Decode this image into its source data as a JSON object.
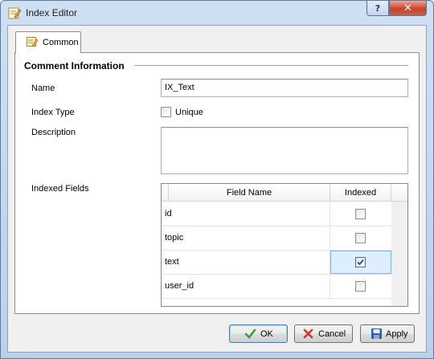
{
  "window": {
    "title": "Index Editor",
    "help_label": "?",
    "close_label": "✕"
  },
  "tabs": [
    {
      "label": "Common",
      "icon": "edit-sheet-icon",
      "active": true
    }
  ],
  "form": {
    "section_title": "Comment Information",
    "name_label": "Name",
    "name_value": "IX_Text",
    "index_type_label": "Index Type",
    "unique_label": "Unique",
    "unique_checked": false,
    "description_label": "Description",
    "description_value": "",
    "indexed_fields_label": "Indexed Fields"
  },
  "grid": {
    "columns": [
      "Field Name",
      "Indexed"
    ],
    "rows": [
      {
        "field": "id",
        "indexed": false
      },
      {
        "field": "topic",
        "indexed": false
      },
      {
        "field": "text",
        "indexed": true
      },
      {
        "field": "user_id",
        "indexed": false
      }
    ]
  },
  "buttons": {
    "ok": "OK",
    "cancel": "Cancel",
    "apply": "Apply"
  },
  "colors": {
    "checkmark": "#2d4f7a",
    "ok_icon": "#39a13a",
    "cancel_icon": "#d23a2e",
    "apply_icon": "#2f5fa8"
  }
}
